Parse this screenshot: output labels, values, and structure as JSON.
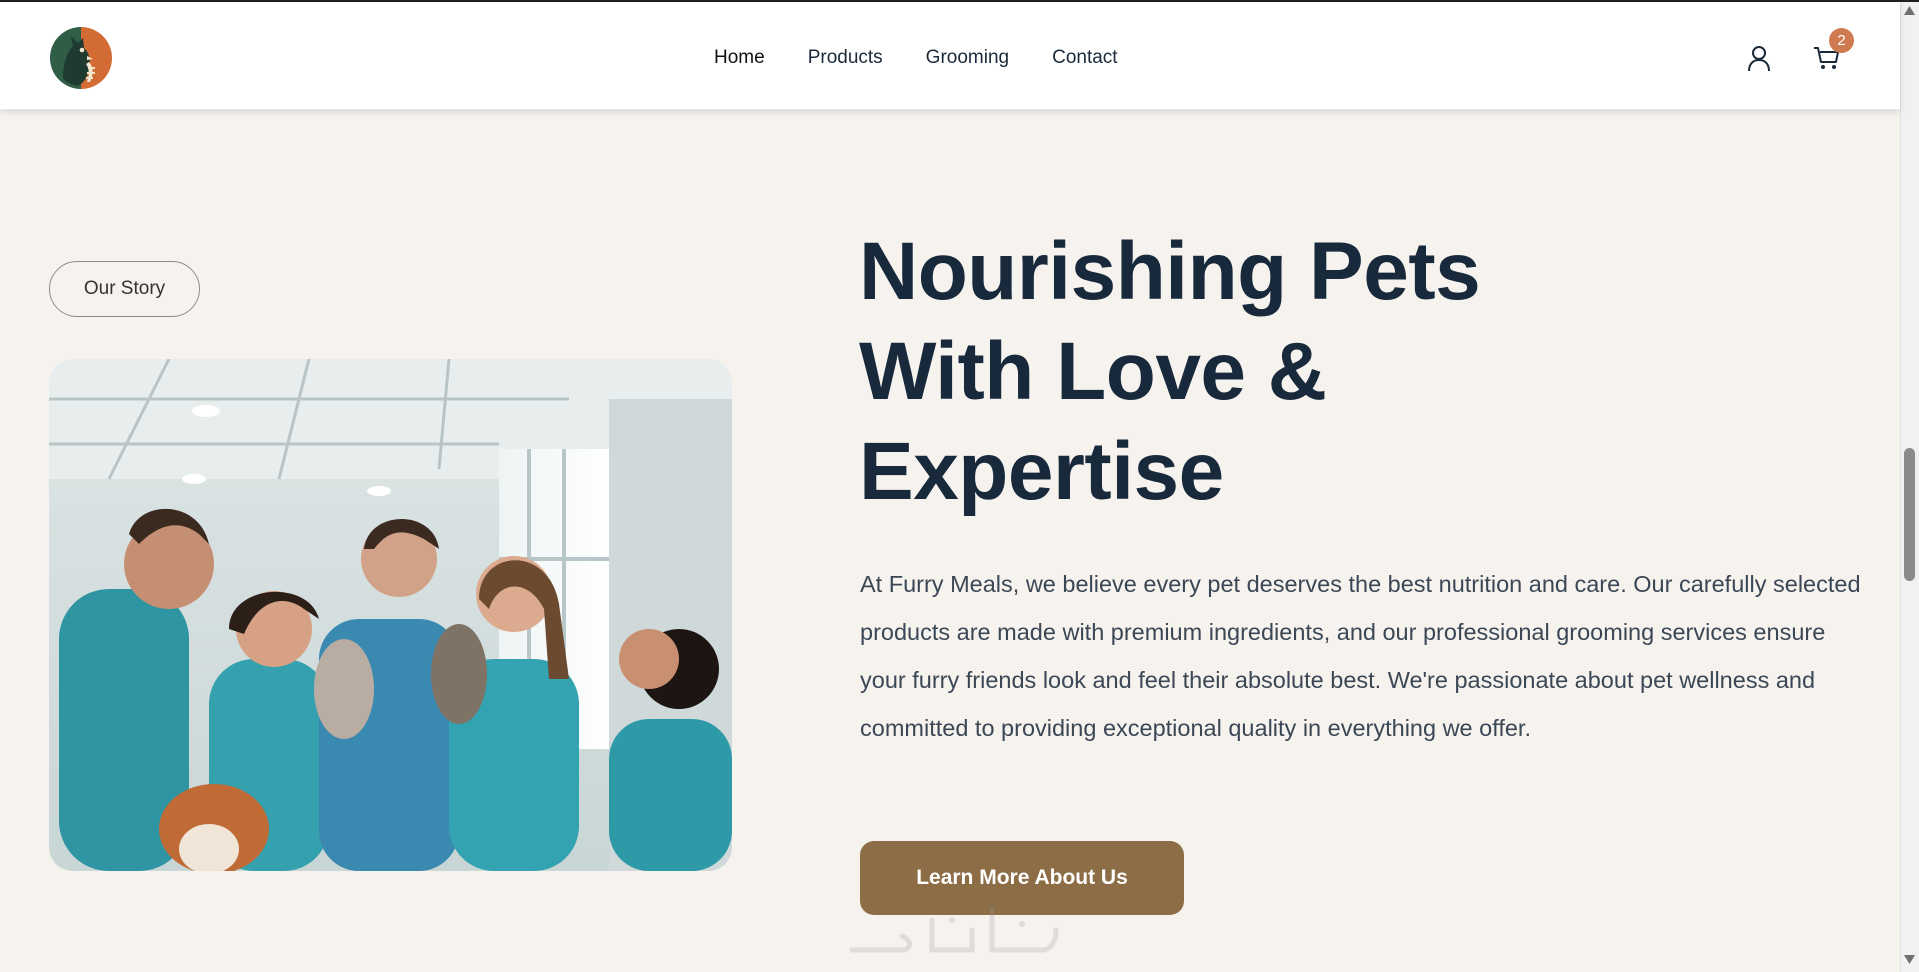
{
  "header": {
    "logo": "furry-meals-logo",
    "nav": [
      {
        "label": "Home"
      },
      {
        "label": "Products"
      },
      {
        "label": "Grooming"
      },
      {
        "label": "Contact"
      }
    ],
    "user_icon": "user-icon",
    "cart_icon": "cart-icon",
    "cart_count": "2"
  },
  "hero": {
    "tag": "Our Story",
    "photo": "vet-team-with-pets-photo",
    "headline_lines": [
      "Nourishing Pets",
      "With Love &",
      "Expertise"
    ],
    "body": "At Furry Meals, we believe every pet deserves the best nutrition and care. Our carefully selected products are made with premium ingredients, and our professional grooming services ensure your furry friends look and feel their absolute best. We're passionate about pet wellness and committed to providing exceptional quality in everything we offer.",
    "cta": "Learn More About Us"
  },
  "colors": {
    "page_bg": "#f6f3ef",
    "headline": "#17293b",
    "cta_bg": "#8c6d46",
    "badge_bg": "#d07a52"
  }
}
